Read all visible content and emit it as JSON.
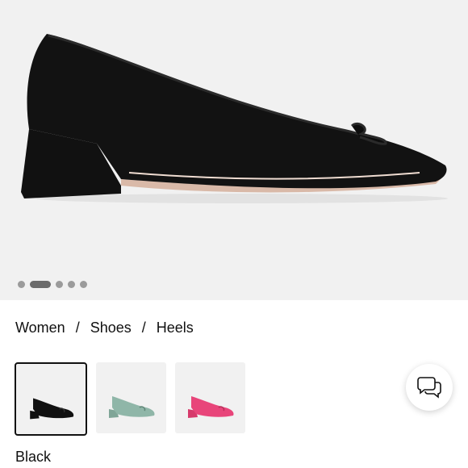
{
  "product": {
    "image_icon": "black-heel-pump-image",
    "carousel": {
      "total": 5,
      "active_index": 1
    }
  },
  "breadcrumb": {
    "items": [
      "Women",
      "Shoes",
      "Heels"
    ],
    "separator": "/"
  },
  "swatches": [
    {
      "name": "black",
      "color": "#111111",
      "selected": true
    },
    {
      "name": "sage",
      "color": "#8fb6a8",
      "selected": false
    },
    {
      "name": "pink",
      "color": "#e8457a",
      "selected": false
    }
  ],
  "selected_color_label": "Black",
  "chat": {
    "icon": "chat-bubbles-icon"
  }
}
